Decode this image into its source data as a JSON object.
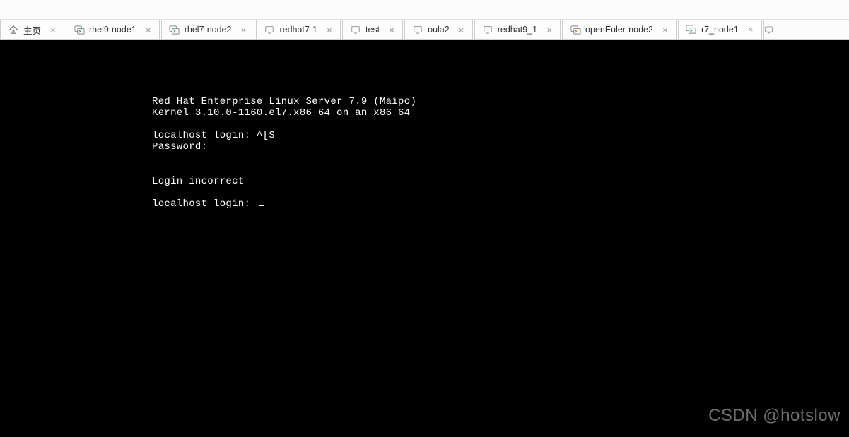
{
  "tabs": [
    {
      "label": "主页",
      "icon": "home",
      "active": false
    },
    {
      "label": "rhel9-node1",
      "icon": "vm",
      "active": false
    },
    {
      "label": "rhel7-node2",
      "icon": "vm",
      "active": false
    },
    {
      "label": "redhat7-1",
      "icon": "vm-gray",
      "active": false
    },
    {
      "label": "test",
      "icon": "vm-gray",
      "active": false
    },
    {
      "label": "oula2",
      "icon": "vm-gray",
      "active": false
    },
    {
      "label": "redhat9_1",
      "icon": "vm-gray",
      "active": false
    },
    {
      "label": "openEuler-node2",
      "icon": "vm-orange",
      "active": false
    },
    {
      "label": "r7_node1",
      "icon": "vm",
      "active": true
    }
  ],
  "console": {
    "line1": "Red Hat Enterprise Linux Server 7.9 (Maipo)",
    "line2": "Kernel 3.10.0-1160.el7.x86_64 on an x86_64",
    "line3": "",
    "line4": "localhost login: ^[S",
    "line5": "Password:",
    "line6": "",
    "line7": "",
    "line8": "Login incorrect",
    "line9": "",
    "line10": "localhost login: "
  },
  "watermark": "CSDN @hotslow"
}
